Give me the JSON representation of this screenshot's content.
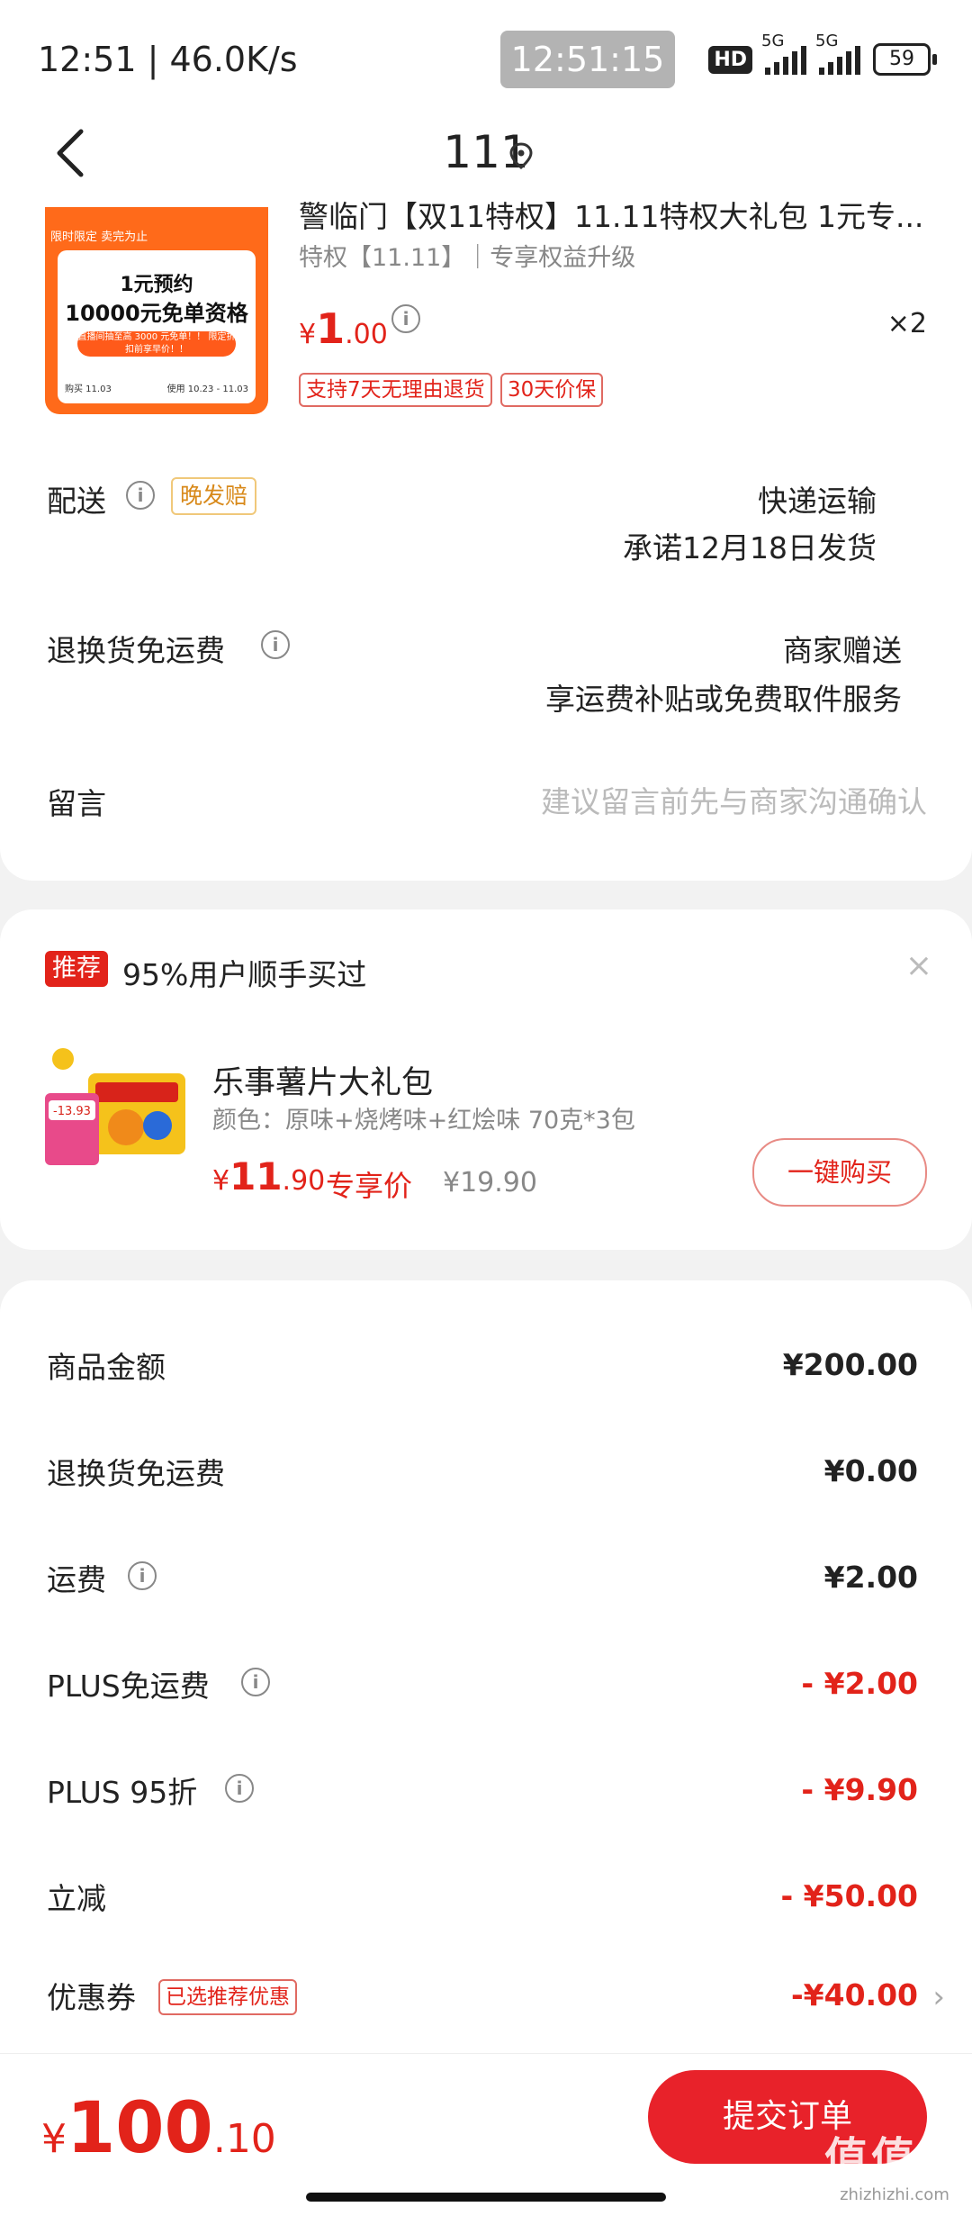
{
  "status_bar": {
    "time_speed": "12:51 | 46.0K/s",
    "clock_overlay": "12:51:15",
    "hd_label": "HD",
    "net1": "5G",
    "net2": "5G",
    "battery": "59"
  },
  "nav": {
    "title": "111"
  },
  "product": {
    "thumb_small": "限时限定 卖完为止",
    "thumb_line1": "1元预约",
    "thumb_line2": "10000元免单资格",
    "thumb_pill": "直播间抽至高 3000 元免单！！ 限定折扣前享早价！！",
    "thumb_foot_left": "购买 11.03",
    "thumb_foot_right": "使用 10.23 - 11.03",
    "title": "警临门【双11特权】11.11特权大礼包 1元专...",
    "spec": "特权【11.11】｜专享权益升级",
    "price_symbol": "¥",
    "price_int": "1",
    "price_dec": ".00",
    "qty": "×2",
    "tag1": "支持7天无理由退货",
    "tag2": "30天价保"
  },
  "delivery": {
    "label": "配送",
    "late_tag": "晚发赔",
    "method": "快递运输",
    "promise": "承诺12月18日发货"
  },
  "return_shipping": {
    "label": "退换货免运费",
    "right1": "商家赠送",
    "right2": "享运费补贴或免费取件服务"
  },
  "message": {
    "label": "留言",
    "placeholder": "建议留言前先与商家沟通确认"
  },
  "recommend": {
    "badge": "推荐",
    "text": "95%用户顺手买过",
    "close": "×",
    "name": "乐事薯片大礼包",
    "spec": "颜色：原味+烧烤味+红烩味 70克*3包",
    "price_symbol": "¥",
    "price_int": "11",
    "price_dec": ".90",
    "exclusive": "专享价",
    "orig_price": "¥19.90",
    "buy_button": "一键购买",
    "img_badge": "-13.93"
  },
  "fees": [
    {
      "label": "商品金额",
      "value": "¥200.00"
    },
    {
      "label": "退换货免运费",
      "value": "¥0.00"
    },
    {
      "label": "运费",
      "value": "¥2.00"
    },
    {
      "label": "PLUS免运费",
      "value": "- ¥2.00"
    },
    {
      "label": "PLUS 95折",
      "value": "- ¥9.90"
    },
    {
      "label": "立减",
      "value": "- ¥50.00"
    },
    {
      "label": "优惠券",
      "value": "-¥40.00",
      "tag": "已选推荐优惠"
    }
  ],
  "footer": {
    "total_symbol": "¥",
    "total_int": "100",
    "total_dec": ".10",
    "submit": "提交订单",
    "watermark_main": "值值值",
    "watermark_site": "zhizhizhi.com"
  },
  "colors": {
    "accent": "#e2231a",
    "submit_bg": "#e8222a",
    "thumb_bg": "#ff6a1a"
  }
}
